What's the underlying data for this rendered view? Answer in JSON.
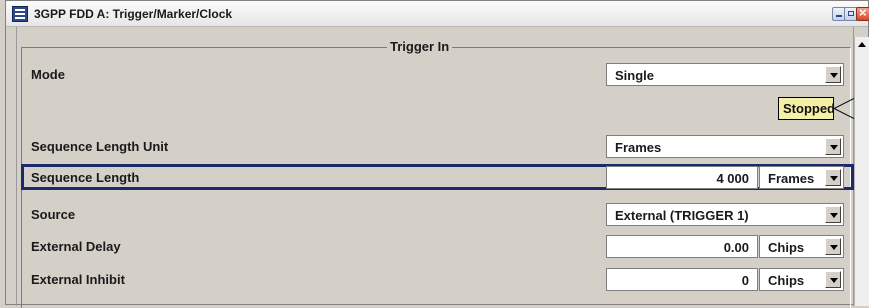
{
  "window": {
    "title": "3GPP FDD A: Trigger/Marker/Clock"
  },
  "section": {
    "title": "Trigger In"
  },
  "rows": {
    "mode": {
      "label": "Mode",
      "value": "Single"
    },
    "status": {
      "text": "Stopped"
    },
    "seq_unit": {
      "label": "Sequence Length Unit",
      "value": "Frames"
    },
    "seq_length": {
      "label": "Sequence Length",
      "value": "4 000",
      "unit": "Frames"
    },
    "source": {
      "label": "Source",
      "value": "External (TRIGGER 1)"
    },
    "ext_delay": {
      "label": "External Delay",
      "value": "0.00",
      "unit": "Chips"
    },
    "ext_inhibit": {
      "label": "External Inhibit",
      "value": "0",
      "unit": "Chips"
    }
  },
  "colors": {
    "highlight": "#1c2a6a",
    "status_bg": "#f4f1a6"
  }
}
